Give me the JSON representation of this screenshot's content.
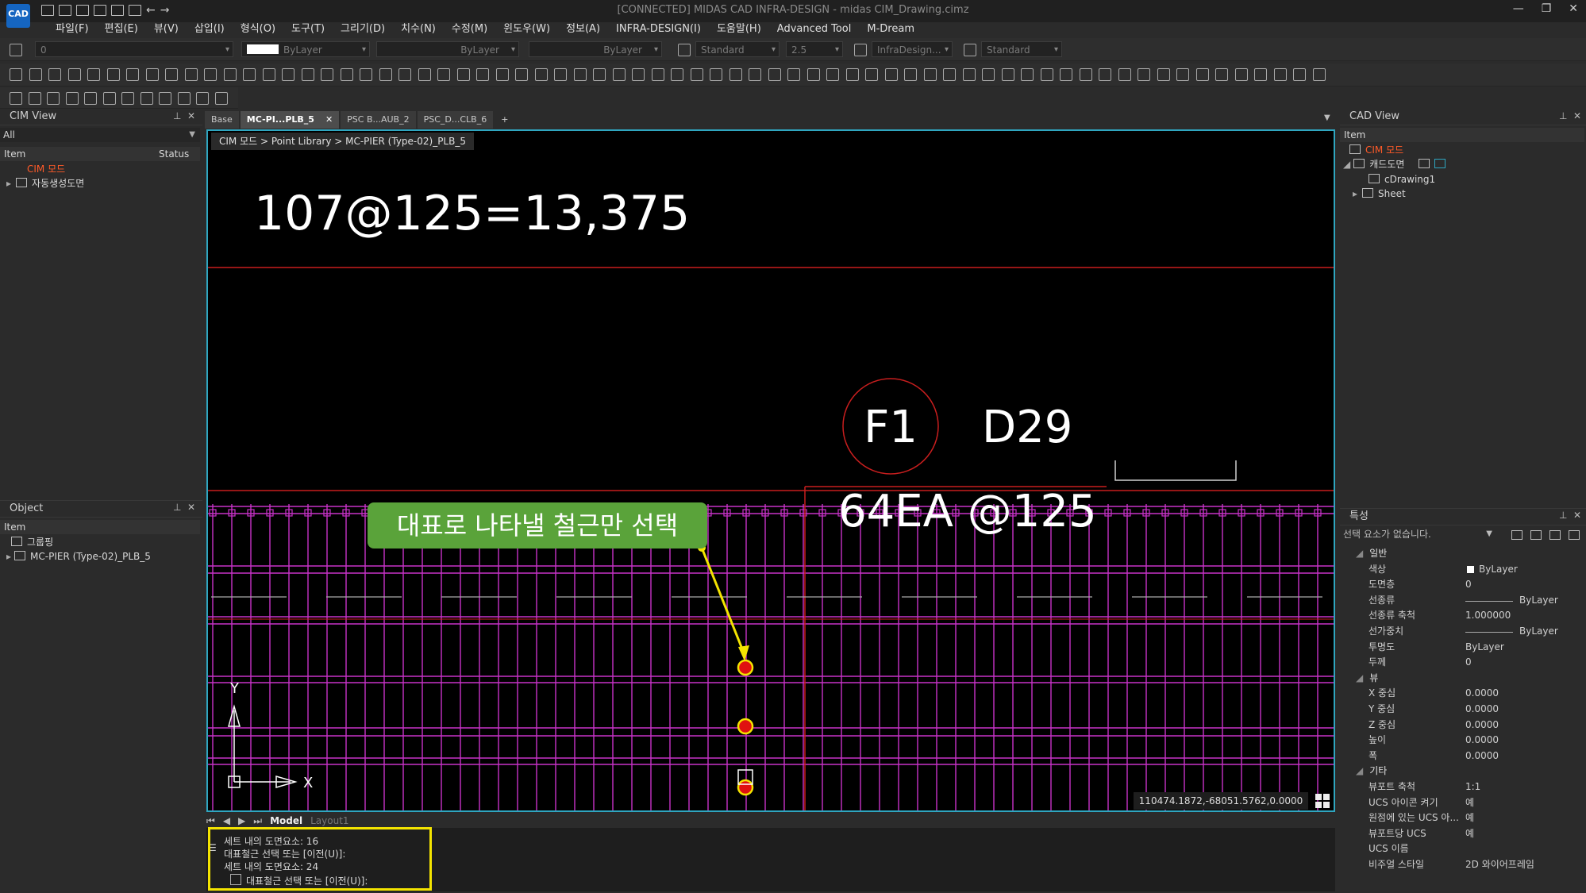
{
  "app": {
    "logo": "CAD",
    "title": "[CONNECTED] MIDAS CAD INFRA-DESIGN - midas CIM_Drawing.cimz",
    "menu": [
      "파일(F)",
      "편집(E)",
      "뷰(V)",
      "삽입(I)",
      "형식(O)",
      "도구(T)",
      "그리기(D)",
      "치수(N)",
      "수정(M)",
      "윈도우(W)",
      "정보(A)",
      "INFRA-DESIGN(I)",
      "도움말(H)",
      "Advanced Tool",
      "M-Dream"
    ]
  },
  "toolbar": {
    "layer_value": "0",
    "color_value": "ByLayer",
    "linetype_value": "ByLayer",
    "lineweight_value": "ByLayer",
    "text_style": "Standard",
    "text_height": "2.5",
    "dim_style": "InfraDesign...",
    "table_style": "Standard"
  },
  "cim_view": {
    "title": "CIM View",
    "filter": "All",
    "col_item": "Item",
    "col_status": "Status",
    "items": [
      "CIM 모드",
      "자동생성도면"
    ]
  },
  "object_panel": {
    "title": "Object",
    "col_item": "Item",
    "items": [
      "그룹핑",
      "MC-PIER (Type-02)_PLB_5"
    ]
  },
  "tabs": [
    "Base",
    "MC-PI...PLB_5",
    "PSC B...AUB_2",
    "PSC_D...CLB_6"
  ],
  "breadcrumb": "CIM 모드 > Point Library > MC-PIER (Type-02)_PLB_5",
  "drawing": {
    "dimension_text": "107@125=13,375",
    "bubble_label": "F1",
    "bar_size": "D29",
    "spacing_text": "64EA  @125",
    "callout": "대표로 나타낼 철근만 선택",
    "ucs_y": "Y",
    "ucs_x": "X",
    "coords": "110474.1872,-68051.5762,0.0000"
  },
  "layout_tabs": [
    "Model",
    "Layout1"
  ],
  "command_lines": [
    "세트 내의 도면요소: 16",
    "대표철근 선택 또는 [이전(U)]:",
    "세트 내의 도면요소: 24",
    "대표철근 선택 또는 [이전(U)]:"
  ],
  "cad_view": {
    "title": "CAD View",
    "col_item": "Item",
    "items": [
      "CIM 모드",
      "캐드도면",
      "cDrawing1",
      "Sheet"
    ]
  },
  "properties": {
    "title": "특성",
    "selection": "선택 요소가 없습니다.",
    "sections": [
      {
        "name": "일반",
        "rows": [
          [
            "색상",
            "ByLayer"
          ],
          [
            "도면층",
            "0"
          ],
          [
            "선종류",
            "ByLayer"
          ],
          [
            "선종류 축척",
            "1.000000"
          ],
          [
            "선가중치",
            "ByLayer"
          ],
          [
            "투명도",
            "ByLayer"
          ],
          [
            "두께",
            "0"
          ]
        ]
      },
      {
        "name": "뷰",
        "rows": [
          [
            "X 중심",
            "0.0000"
          ],
          [
            "Y 중심",
            "0.0000"
          ],
          [
            "Z 중심",
            "0.0000"
          ],
          [
            "높이",
            "0.0000"
          ],
          [
            "폭",
            "0.0000"
          ]
        ]
      },
      {
        "name": "기타",
        "rows": [
          [
            "뷰포트 축척",
            "1:1"
          ],
          [
            "UCS 아이콘 켜기",
            "예"
          ],
          [
            "원점에 있는 UCS 아...",
            "예"
          ],
          [
            "뷰포트당 UCS",
            "예"
          ],
          [
            "UCS 이름",
            ""
          ],
          [
            "비주얼 스타일",
            "2D 와이어프레임"
          ]
        ]
      }
    ]
  },
  "colors": {
    "accent": "#2fa6c0",
    "rebar": "#c832c8",
    "redline": "#c81e1e",
    "callout": "#5aa33a",
    "highlight": "#f4e400",
    "tree_red": "#ff5a28"
  }
}
